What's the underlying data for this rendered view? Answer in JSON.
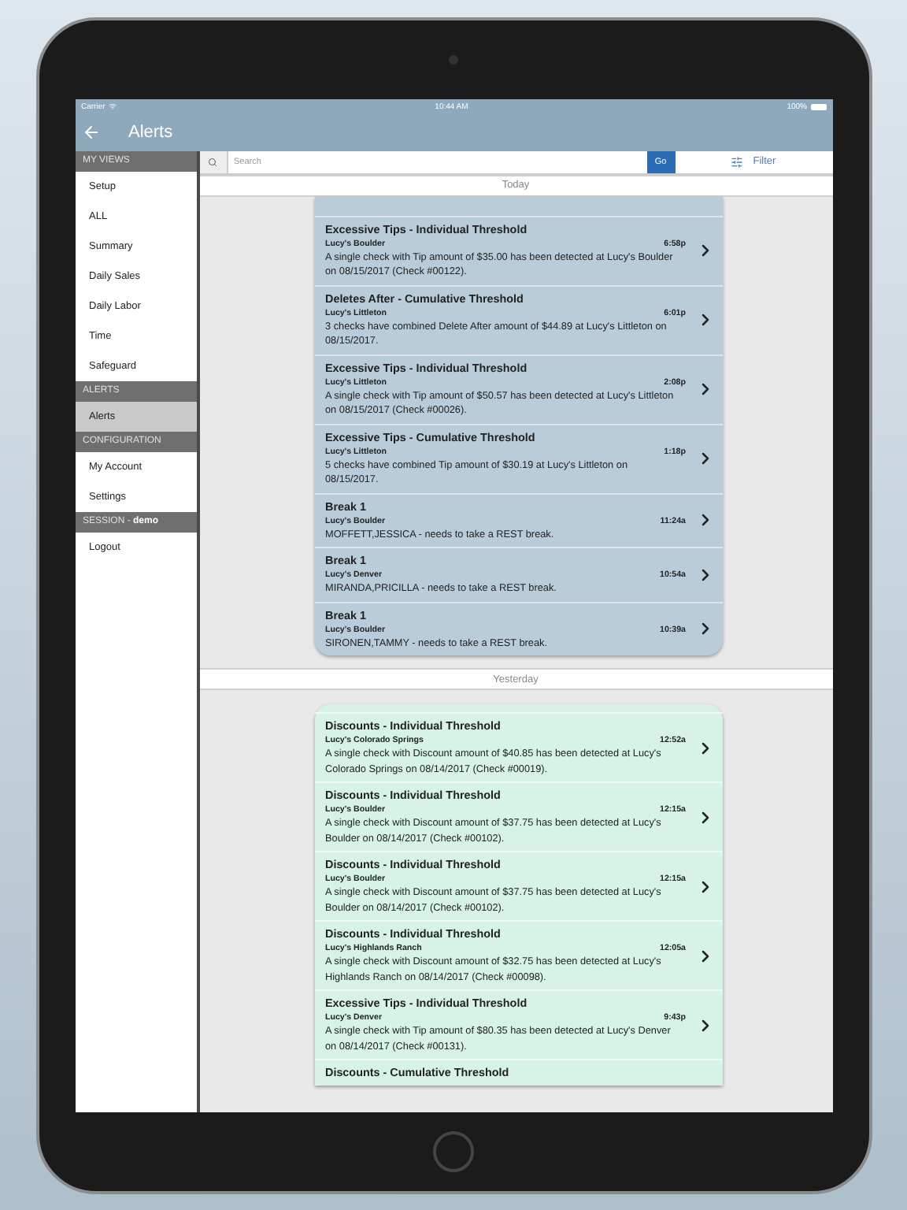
{
  "status_bar": {
    "carrier": "Carrier",
    "time": "10:44 AM",
    "battery": "100%"
  },
  "nav": {
    "title": "Alerts"
  },
  "sidebar": [
    {
      "header": "MY VIEWS",
      "items": [
        {
          "label": "Setup",
          "selected": false
        },
        {
          "label": "ALL",
          "selected": false
        },
        {
          "label": "Summary",
          "selected": false
        },
        {
          "label": "Daily Sales",
          "selected": false
        },
        {
          "label": "Daily Labor",
          "selected": false
        },
        {
          "label": "Time",
          "selected": false
        },
        {
          "label": "Safeguard",
          "selected": false
        }
      ]
    },
    {
      "header": "ALERTS",
      "items": [
        {
          "label": "Alerts",
          "selected": true
        }
      ]
    },
    {
      "header": "CONFIGURATION",
      "items": [
        {
          "label": "My Account",
          "selected": false
        },
        {
          "label": "Settings",
          "selected": false
        }
      ]
    },
    {
      "header": "SESSION - **demo**",
      "items": [
        {
          "label": "Logout",
          "selected": false
        }
      ]
    }
  ],
  "search": {
    "placeholder": "Search",
    "go": "Go",
    "filter": "Filter"
  },
  "sections": [
    {
      "header": "Today",
      "color": "#b9ccd9",
      "alerts": [
        {
          "title": "Excessive Tips - Individual Threshold",
          "store": "Lucy's Boulder",
          "time": "6:58p",
          "message": "A single check with Tip amount of $35.00 has been detected at Lucy's Boulder on 08/15/2017 (Check #00122)."
        },
        {
          "title": "Deletes After - Cumulative Threshold",
          "store": "Lucy's Littleton",
          "time": "6:01p",
          "message": "3 checks have combined Delete After amount of $44.89 at Lucy's Littleton on 08/15/2017."
        },
        {
          "title": "Excessive Tips - Individual Threshold",
          "store": "Lucy's Littleton",
          "time": "2:08p",
          "message": "A single check with Tip amount of $50.57 has been detected at Lucy's Littleton on 08/15/2017 (Check #00026)."
        },
        {
          "title": "Excessive Tips - Cumulative Threshold",
          "store": "Lucy's Littleton",
          "time": "1:18p",
          "message": "5 checks have combined Tip amount of $30.19 at Lucy's Littleton on 08/15/2017."
        },
        {
          "title": "Break 1",
          "store": "Lucy's Boulder",
          "time": "11:24a",
          "message": "MOFFETT,JESSICA - needs to take a REST break."
        },
        {
          "title": "Break 1",
          "store": "Lucy's Denver",
          "time": "10:54a",
          "message": "MIRANDA,PRICILLA - needs to take a REST break."
        },
        {
          "title": "Break 1",
          "store": "Lucy's Boulder",
          "time": "10:39a",
          "message": "SIRONEN,TAMMY - needs to take a REST break."
        }
      ]
    },
    {
      "header": "Yesterday",
      "color": "#d7f3e5",
      "alerts": [
        {
          "title": "Discounts - Individual Threshold",
          "store": "Lucy's Colorado Springs",
          "time": "12:52a",
          "message": "A single check with Discount amount of $40.85 has been detected at Lucy's Colorado Springs on 08/14/2017 (Check #00019)."
        },
        {
          "title": "Discounts - Individual Threshold",
          "store": "Lucy's Boulder",
          "time": "12:15a",
          "message": "A single check with Discount amount of $37.75 has been detected at Lucy's Boulder on 08/14/2017 (Check #00102)."
        },
        {
          "title": "Discounts - Individual Threshold",
          "store": "Lucy's Boulder",
          "time": "12:15a",
          "message": "A single check with Discount amount of $37.75 has been detected at Lucy's Boulder on 08/14/2017 (Check #00102)."
        },
        {
          "title": "Discounts - Individual Threshold",
          "store": "Lucy's Highlands Ranch",
          "time": "12:05a",
          "message": "A single check with Discount amount of $32.75 has been detected at Lucy's Highlands Ranch on 08/14/2017 (Check #00098)."
        },
        {
          "title": "Excessive Tips - Individual Threshold",
          "store": "Lucy's Denver",
          "time": "9:43p",
          "message": "A single check with Tip amount of $80.35 has been detected at Lucy's Denver on 08/14/2017 (Check #00131)."
        },
        {
          "title": "Discounts - Cumulative Threshold"
        }
      ]
    }
  ]
}
